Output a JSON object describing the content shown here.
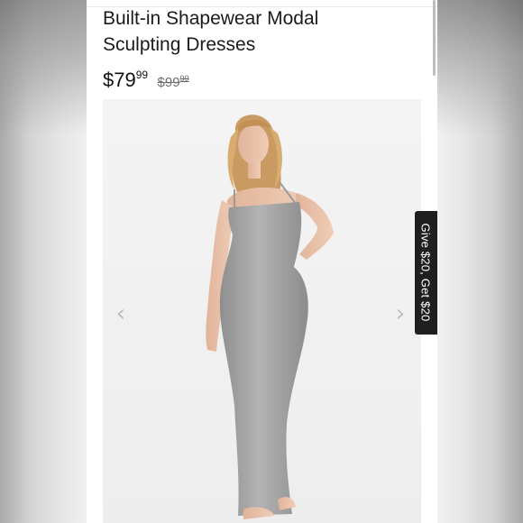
{
  "product": {
    "title_line1": "Built-in Shapewear Modal",
    "title_line2": "Sculpting Dresses",
    "price": {
      "currency": "$",
      "current_whole": "79",
      "current_cents": "99",
      "original_whole": "99",
      "original_cents": "99"
    }
  },
  "gallery": {
    "prev_icon": "chevron-left-icon",
    "next_icon": "chevron-right-icon",
    "prev_glyph": "‹",
    "next_glyph": "›",
    "image_subject": "model-in-grey-maxi-dress"
  },
  "referral_tab": {
    "label": "Give $20, Get $20"
  },
  "colors": {
    "dress": "#a9a9a9",
    "tab_bg": "#1f1f1f",
    "gallery_bg": "#f0f0f0"
  }
}
